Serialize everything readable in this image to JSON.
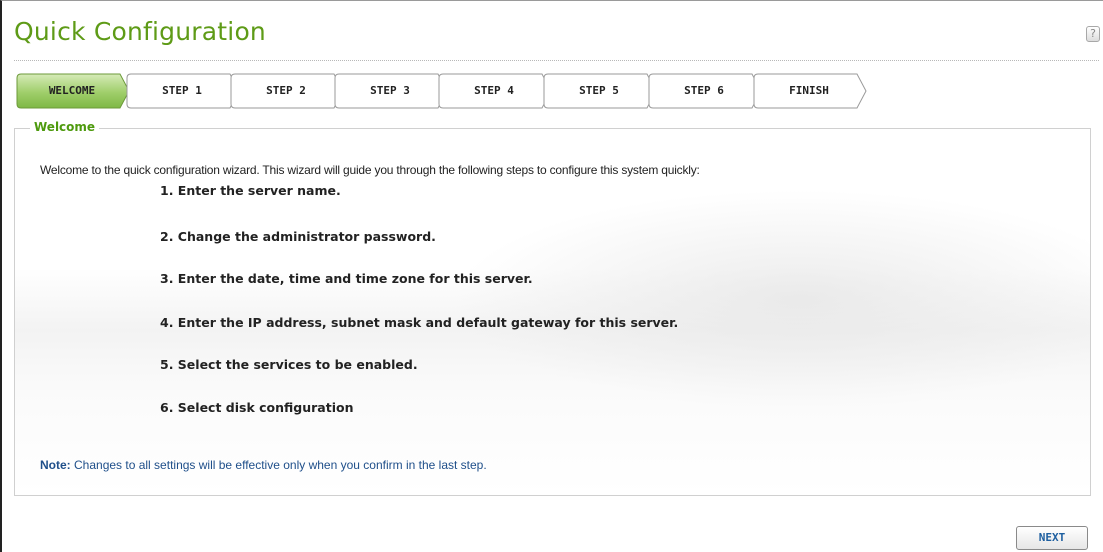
{
  "title": "Quick Configuration",
  "help_icon": "?",
  "steps": [
    {
      "label": "WELCOME",
      "active": true
    },
    {
      "label": "STEP 1",
      "active": false
    },
    {
      "label": "STEP 2",
      "active": false
    },
    {
      "label": "STEP 3",
      "active": false
    },
    {
      "label": "STEP 4",
      "active": false
    },
    {
      "label": "STEP 5",
      "active": false
    },
    {
      "label": "STEP 6",
      "active": false
    },
    {
      "label": "FINISH",
      "active": false
    }
  ],
  "section_legend": "Welcome",
  "intro": "Welcome to the quick configuration wizard. This wizard will guide you through the following steps to configure this system quickly:",
  "items": [
    "1. Enter the server name.",
    "2. Change the administrator password.",
    "3. Enter the date, time and time zone for this server.",
    "4. Enter the IP address, subnet mask and default gateway for this server.",
    "5. Select the services to be enabled.",
    "6. Select disk configuration"
  ],
  "note": {
    "label": "Note:",
    "text": " Changes to all settings will be effective only when you confirm in the last step."
  },
  "next_label": "NEXT",
  "colors": {
    "title": "#5e9b17",
    "active_step_fill": "#9fce6a",
    "legend": "#4e9a0e",
    "note": "#1f4f8a",
    "next": "#1e5fa0"
  }
}
